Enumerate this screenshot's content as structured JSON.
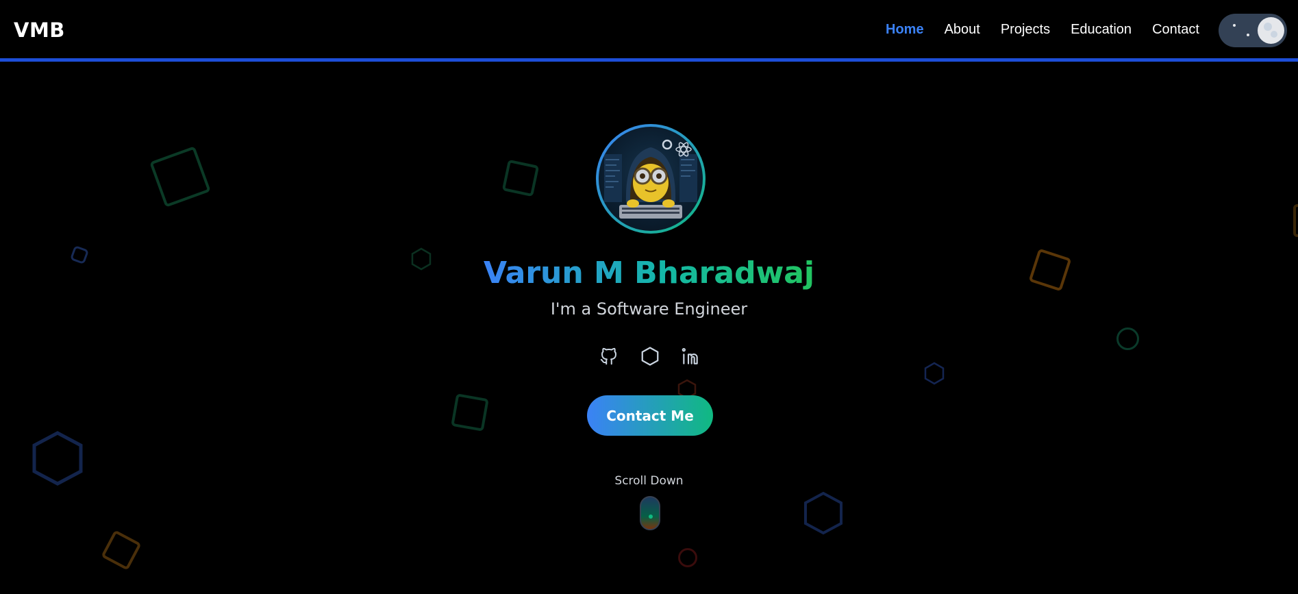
{
  "brand": {
    "logo_text": "VMB"
  },
  "nav": {
    "items": [
      {
        "label": "Home",
        "active": true
      },
      {
        "label": "About",
        "active": false
      },
      {
        "label": "Projects",
        "active": false
      },
      {
        "label": "Education",
        "active": false
      },
      {
        "label": "Contact",
        "active": false
      }
    ],
    "theme_toggle": {
      "icon": "moon-icon",
      "mode": "dark"
    }
  },
  "hero": {
    "name": "Varun M Bharadwaj",
    "subtitle": "I'm a Software Engineer",
    "socials": [
      {
        "icon": "github-icon"
      },
      {
        "icon": "hexagon-icon"
      },
      {
        "icon": "linkedin-icon"
      }
    ],
    "cta_label": "Contact Me",
    "scroll_label": "Scroll Down"
  },
  "colors": {
    "accent": "#1d4ed8",
    "nav_active": "#3b82f6",
    "gradient_start": "#3b82f6",
    "gradient_end": "#10b981",
    "background": "#000000"
  }
}
